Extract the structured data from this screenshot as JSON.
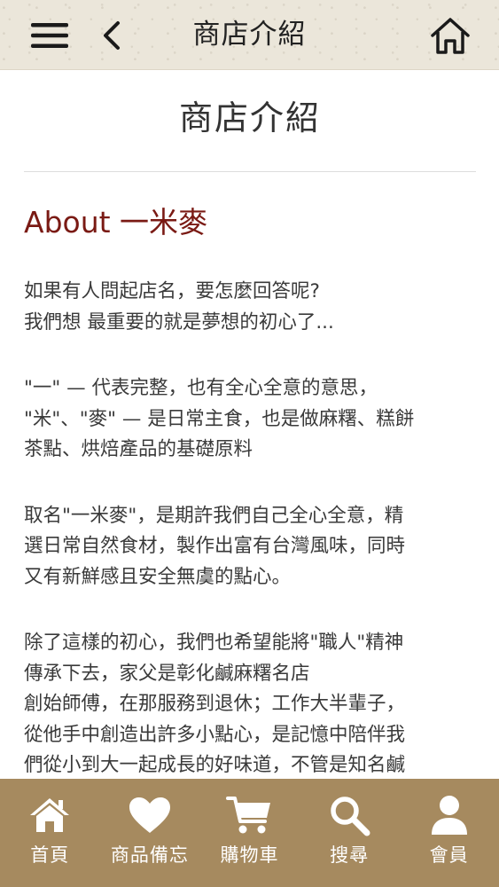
{
  "header": {
    "title": "商店介紹"
  },
  "main": {
    "page_title": "商店介紹",
    "about_heading": "About 一米麥",
    "paragraphs": [
      [
        "如果有人問起店名，要怎麼回答呢?",
        "我們想 最重要的就是夢想的初心了..."
      ],
      [
        "\"一\" — 代表完整，也有全心全意的意思，",
        "\"米\"、\"麥\" — 是日常主食，也是做麻糬、糕餅",
        "茶點、烘焙產品的基礎原料"
      ],
      [
        "取名\"一米麥\"，是期許我們自己全心全意，精",
        "選日常自然食材，製作出富有台灣風味，同時",
        "又有新鮮感且安全無虞的點心。"
      ],
      [
        "除了這樣的初心，我們也希望能將\"職人\"精神",
        "傳承下去，家父是彰化鹹麻糬名店",
        "創始師傅，在那服務到退休；工作大半輩子，",
        "從他手中創造出許多小點心，是記憶中陪伴我",
        "們從小到大一起成長的好味道，不管是知名鹹"
      ]
    ]
  },
  "tabbar": {
    "items": [
      {
        "label": "首頁",
        "icon": "home-icon"
      },
      {
        "label": "商品備忘",
        "icon": "heart-icon"
      },
      {
        "label": "購物車",
        "icon": "cart-icon"
      },
      {
        "label": "搜尋",
        "icon": "search-icon"
      },
      {
        "label": "會員",
        "icon": "user-icon"
      }
    ]
  },
  "colors": {
    "header_bg": "#ebe6da",
    "accent_heading": "#7a1a14",
    "tabbar_bg": "#a68a5f",
    "tab_label": "#ffffff"
  }
}
